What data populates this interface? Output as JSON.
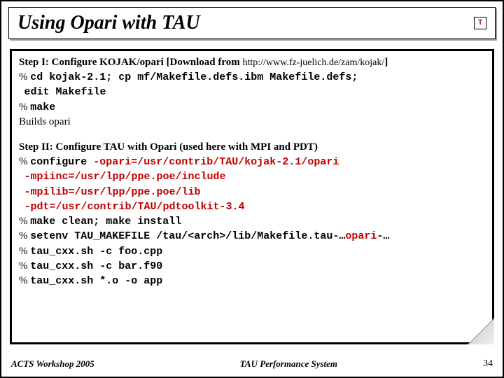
{
  "title": "Using Opari with TAU",
  "logo_text": "T",
  "step1": {
    "label_bold": "Step I: Configure KOJAK/opari [Download from ",
    "url": "http://www.fz-juelich.de/zam/kojak/",
    "label_end": "]",
    "lines": [
      {
        "prompt": "% ",
        "cmd": "cd kojak-2.1; cp mf/Makefile.defs.ibm Makefile.defs;"
      },
      {
        "prompt": "  ",
        "cmd": "edit Makefile"
      },
      {
        "prompt": "% ",
        "cmd": "make"
      }
    ],
    "result": "Builds opari"
  },
  "step2": {
    "label": "Step II: Configure TAU with Opari (used here with MPI and PDT)",
    "lines": [
      {
        "prompt": "% ",
        "pre": "configure ",
        "opt": "-opari=/usr/contrib/TAU/kojak-2.1/opari",
        "post": ""
      },
      {
        "prompt": "  ",
        "pre": "",
        "opt": "-mpiinc=/usr/lpp/ppe.poe/include",
        "post": ""
      },
      {
        "prompt": "  ",
        "pre": "",
        "opt": "-mpilib=/usr/lpp/ppe.poe/lib",
        "post": ""
      },
      {
        "prompt": "  ",
        "pre": "",
        "opt": "-pdt=/usr/contrib/TAU/pdtoolkit-3.4",
        "post": ""
      },
      {
        "prompt": "% ",
        "pre": "make clean; make install",
        "opt": "",
        "post": ""
      },
      {
        "prompt": "% ",
        "pre": "setenv TAU_MAKEFILE /tau/<arch>/lib/Makefile.tau-…",
        "opt": "opari",
        "post": "-…"
      },
      {
        "prompt": "% ",
        "pre": "tau_cxx.sh -c foo.cpp",
        "opt": "",
        "post": ""
      },
      {
        "prompt": "% ",
        "pre": "tau_cxx.sh -c bar.f90",
        "opt": "",
        "post": ""
      },
      {
        "prompt": "% ",
        "pre": "tau_cxx.sh *.o -o app",
        "opt": "",
        "post": ""
      }
    ]
  },
  "footer": {
    "left": "ACTS Workshop 2005",
    "center": "TAU Performance System",
    "right": "34"
  }
}
